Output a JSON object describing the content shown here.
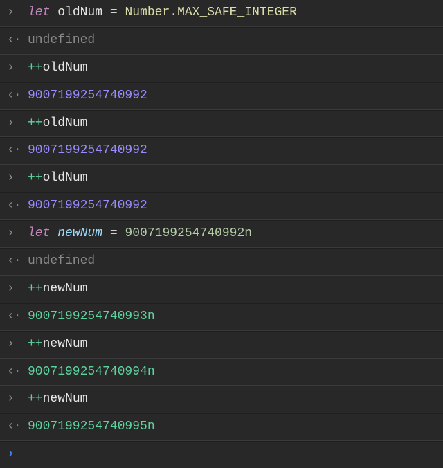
{
  "markers": {
    "input": "›",
    "output": "‹·",
    "prompt": "›"
  },
  "lines": {
    "l1": {
      "kw": "let",
      "var": "oldNum",
      "eq": " = ",
      "global": "Number",
      "dot": ".",
      "const": "MAX_SAFE_INTEGER"
    },
    "l2": {
      "text": "undefined"
    },
    "l3": {
      "op": "++",
      "var": "oldNum"
    },
    "l4": {
      "text": "9007199254740992"
    },
    "l5": {
      "op": "++",
      "var": "oldNum"
    },
    "l6": {
      "text": "9007199254740992"
    },
    "l7": {
      "op": "++",
      "var": "oldNum"
    },
    "l8": {
      "text": "9007199254740992"
    },
    "l9": {
      "kw": "let",
      "var": "newNum",
      "eq": " = ",
      "num": "9007199254740992n"
    },
    "l10": {
      "text": "undefined"
    },
    "l11": {
      "op": "++",
      "var": "newNum"
    },
    "l12": {
      "text": "9007199254740993n"
    },
    "l13": {
      "op": "++",
      "var": "newNum"
    },
    "l14": {
      "text": "9007199254740994n"
    },
    "l15": {
      "op": "++",
      "var": "newNum"
    },
    "l16": {
      "text": "9007199254740995n"
    }
  }
}
